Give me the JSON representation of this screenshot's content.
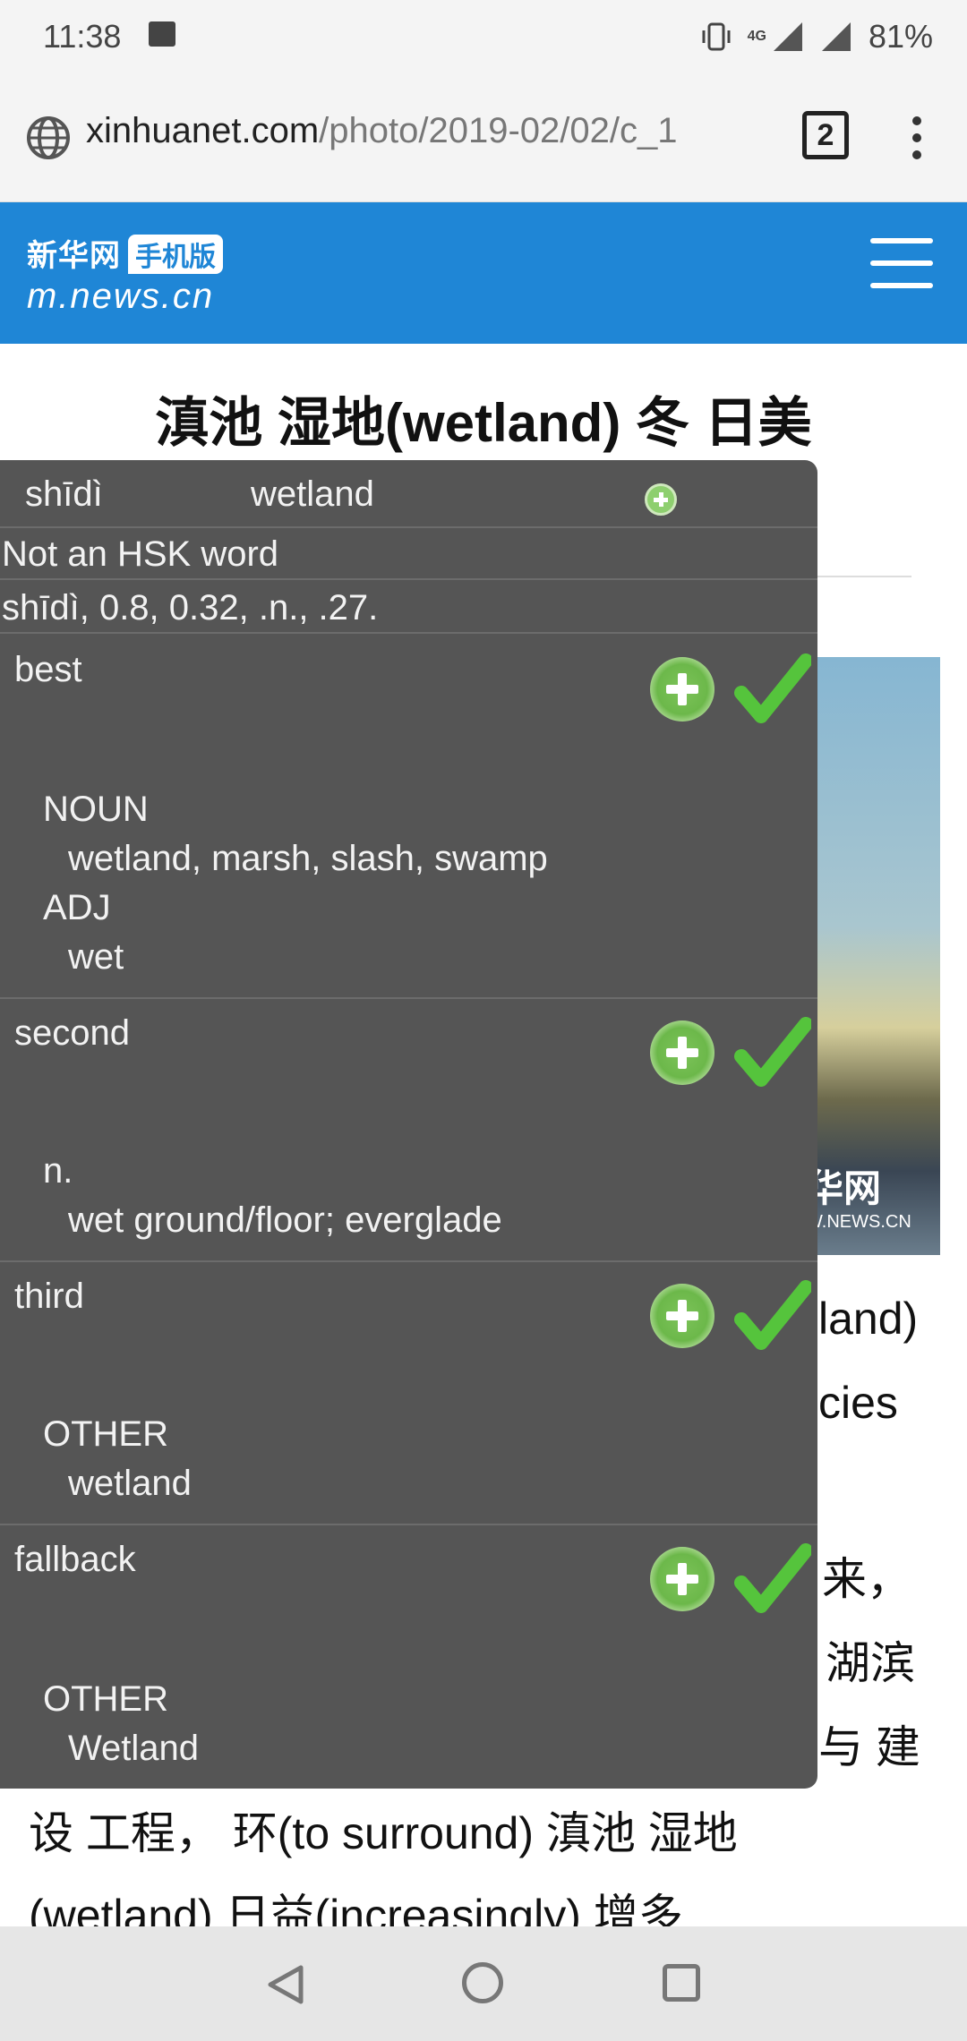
{
  "status_bar": {
    "time": "11:38",
    "network": "4G",
    "battery": "81%"
  },
  "url_bar": {
    "domain": "xinhuanet.com",
    "path": "/photo/2019-02/02/c_1",
    "tab_count": "2"
  },
  "site_header": {
    "logo_top": "新华网",
    "logo_badge": "手机版",
    "logo_url": "m.news.cn"
  },
  "article": {
    "title": "滇池 湿地(wetland) 冬 日美",
    "fragments": [
      "land)",
      "cies",
      "来，",
      "湖滨",
      "与 建"
    ],
    "line_1": "设 工程， 环(to surround) 滇池 湿地",
    "line_2": "(wetland) 日益(increasingly) 增多",
    "photo_watermark": "华网",
    "photo_watermark_sub": "W.NEWS.CN"
  },
  "popup": {
    "pinyin": "shīdì",
    "word": "wetland",
    "hsk": "Not an HSK word",
    "stats": "shīdì, 0.8, 0.32, .n., .27.",
    "sections": [
      {
        "title": "best",
        "entries": [
          {
            "pos": "NOUN",
            "def": "wetland, marsh, slash, swamp"
          },
          {
            "pos": "ADJ",
            "def": "wet"
          }
        ]
      },
      {
        "title": "second",
        "entries": [
          {
            "pos": "n.",
            "def": "wet ground/floor; everglade"
          }
        ]
      },
      {
        "title": "third",
        "entries": [
          {
            "pos": "OTHER",
            "def": "wetland"
          }
        ]
      },
      {
        "title": "fallback",
        "entries": [
          {
            "pos": "OTHER",
            "def": "Wetland"
          }
        ]
      }
    ]
  },
  "colors": {
    "header_blue": "#1f86d6",
    "popup_bg": "#555555",
    "check_green": "#55c43c"
  }
}
